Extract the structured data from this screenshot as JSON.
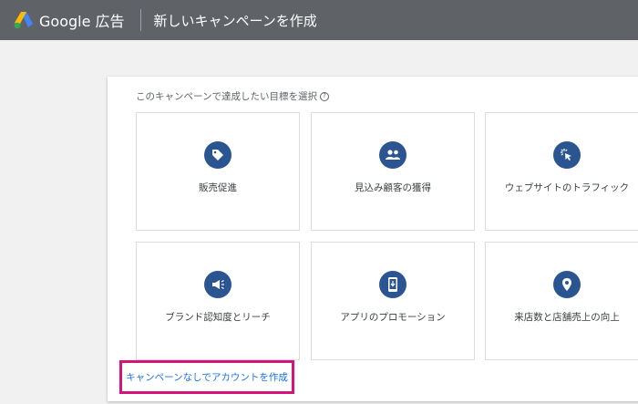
{
  "header": {
    "brand": "Google 広告",
    "title": "新しいキャンペーンを作成"
  },
  "prompt": {
    "text": "このキャンペーンで達成したい目標を選択",
    "help_glyph": "?"
  },
  "goals": [
    {
      "label": "販売促進",
      "icon": "tag-icon"
    },
    {
      "label": "見込み顧客の獲得",
      "icon": "people-icon"
    },
    {
      "label": "ウェブサイトのトラフィック",
      "icon": "cursor-click-icon"
    },
    {
      "label": "ブランド認知度とリーチ",
      "icon": "megaphone-icon"
    },
    {
      "label": "アプリのプロモーション",
      "icon": "phone-download-icon"
    },
    {
      "label": "来店数と店舗売上の向上",
      "icon": "location-pin-icon"
    }
  ],
  "footer_link": "キャンペーンなしでアカウントを作成",
  "colors": {
    "header_bg": "#5f6368",
    "icon_circle": "#2b5591",
    "highlight": "#d7127a",
    "link": "#1a73e8"
  }
}
